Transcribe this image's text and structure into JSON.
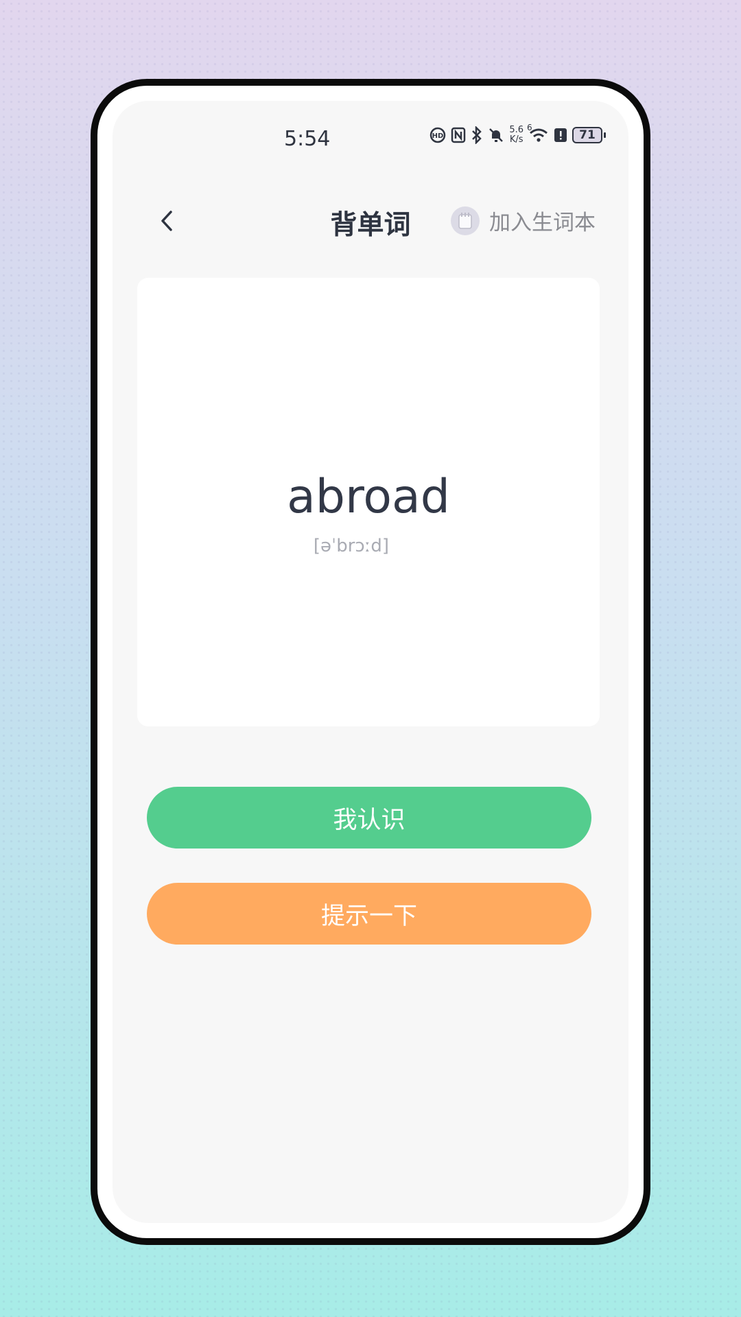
{
  "status_bar": {
    "time": "5:54",
    "net_speed_value": "5.6",
    "net_speed_unit": "K/s",
    "network_label": "6",
    "battery_level": "71",
    "icons": [
      "hd-icon",
      "nfc-icon",
      "bluetooth-icon",
      "bell-muted-icon",
      "wifi-icon",
      "alert-icon",
      "battery-icon"
    ]
  },
  "header": {
    "back_icon": "chevron-left-icon",
    "title": "背单词",
    "add_vocab_icon": "notebook-icon",
    "add_vocab_label": "加入生词本"
  },
  "card": {
    "word": "abroad",
    "phonetic": "[əˈbrɔːd]"
  },
  "actions": {
    "know_label": "我认识",
    "hint_label": "提示一下"
  },
  "colors": {
    "know_button": "#54cd8e",
    "hint_button": "#ffaa5f",
    "title_text": "#2e3441"
  }
}
